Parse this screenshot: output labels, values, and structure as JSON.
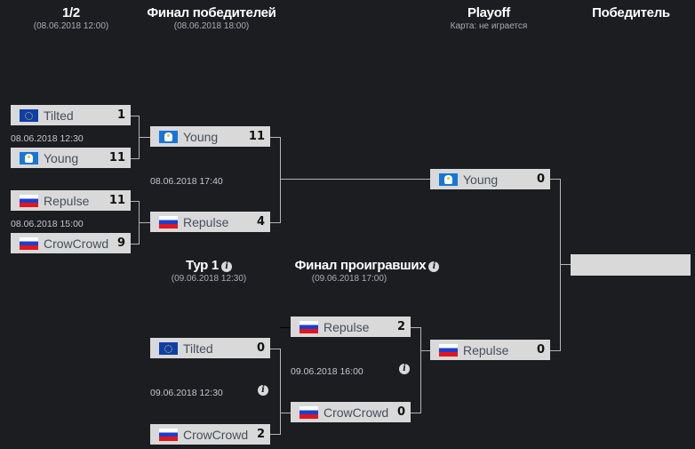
{
  "columns": [
    {
      "id": "semifinal",
      "title": "1/2",
      "subtitle": "(08.06.2018 12:00)"
    },
    {
      "id": "winners-final",
      "title": "Финал победителей",
      "subtitle": "(08.06.2018 18:00)"
    },
    {
      "id": "playoff",
      "title": "Playoff",
      "subtitle": "Карта: не играется"
    },
    {
      "id": "winner",
      "title": "Победитель",
      "subtitle": ""
    },
    {
      "id": "round1",
      "title": "Тур 1",
      "subtitle": "(09.06.2018 12:30)",
      "info_icon": "i"
    },
    {
      "id": "losers-final",
      "title": "Финал проигравших",
      "subtitle": "(09.06.2018 17:00)",
      "info_icon": "i"
    }
  ],
  "matches": [
    {
      "id": "sf1",
      "time": "08.06.2018 12:30",
      "teams": [
        {
          "name": "Tilted",
          "flag": "eu-flag",
          "score": "1"
        },
        {
          "name": "Young",
          "flag": "team-logo",
          "score": "11"
        }
      ]
    },
    {
      "id": "sf2",
      "time": "08.06.2018 15:00",
      "teams": [
        {
          "name": "Repulse",
          "flag": "ru-flag",
          "score": "11"
        },
        {
          "name": "CrowCrowd",
          "flag": "ru-flag",
          "score": "9"
        }
      ]
    },
    {
      "id": "wf",
      "time": "08.06.2018 17:40",
      "teams": [
        {
          "name": "Young",
          "flag": "team-logo",
          "score": "11"
        },
        {
          "name": "Repulse",
          "flag": "ru-flag",
          "score": "4"
        }
      ]
    },
    {
      "id": "r1",
      "time": "09.06.2018 12:30",
      "info_icon": "i",
      "teams": [
        {
          "name": "Tilted",
          "flag": "eu-flag",
          "score": "0"
        },
        {
          "name": "CrowCrowd",
          "flag": "ru-flag",
          "score": "2"
        }
      ]
    },
    {
      "id": "lf",
      "time": "09.06.2018 16:00",
      "info_icon": "i",
      "teams": [
        {
          "name": "Repulse",
          "flag": "ru-flag",
          "score": "2"
        },
        {
          "name": "CrowCrowd",
          "flag": "ru-flag",
          "score": "0"
        }
      ]
    },
    {
      "id": "po",
      "time": "",
      "teams": [
        {
          "name": "Young",
          "flag": "team-logo",
          "score": "0"
        },
        {
          "name": "Repulse",
          "flag": "ru-flag",
          "score": "0"
        }
      ]
    }
  ],
  "winner": {
    "name": ""
  },
  "colors": {
    "background": "#1c1d21",
    "box": "#d9d9d9",
    "connector": "#b5b5b5",
    "team_text": "#454f5b",
    "subtitle": "#a9acb3"
  }
}
